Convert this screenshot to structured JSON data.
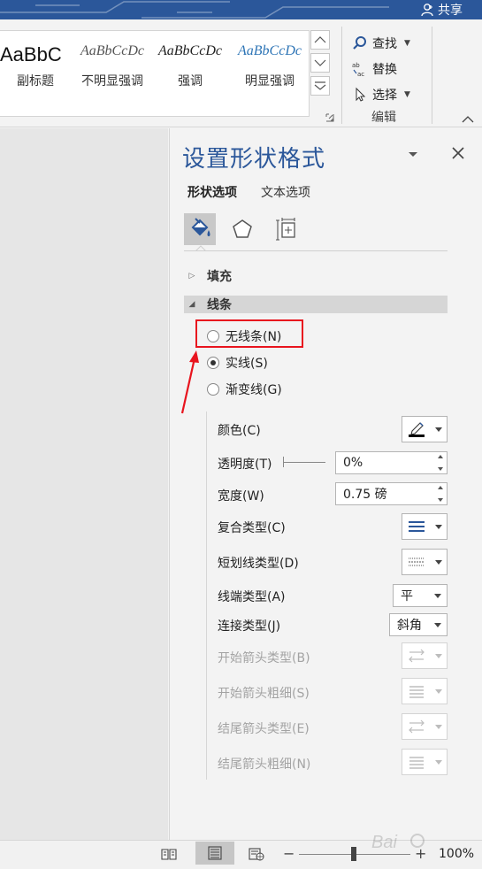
{
  "titlebar": {
    "share_label": "共享",
    "accent": "#2b579a"
  },
  "ribbon": {
    "styles": [
      {
        "sample": "AaBbC",
        "name": "副标题"
      },
      {
        "sample": "AaBbCcDc",
        "name": "不明显强调"
      },
      {
        "sample": "AaBbCcDc",
        "name": "强调"
      },
      {
        "sample": "AaBbCcDc",
        "name": "明显强调"
      }
    ],
    "edit_group": {
      "find": "查找",
      "replace": "替换",
      "select": "选择",
      "label": "编辑"
    }
  },
  "pane": {
    "title": "设置形状格式",
    "tabs": [
      "形状选项",
      "文本选项"
    ],
    "sections": {
      "fill": "填充",
      "line": "线条"
    },
    "line_options": [
      {
        "label": "无线条(N)",
        "checked": false,
        "highlighted": true
      },
      {
        "label": "实线(S)",
        "checked": true
      },
      {
        "label": "渐变线(G)",
        "checked": false
      }
    ],
    "properties": {
      "color": "颜色(C)",
      "transparency": "透明度(T)",
      "transparency_value": "0%",
      "width": "宽度(W)",
      "width_value": "0.75 磅",
      "compound_type": "复合类型(C)",
      "dash_type": "短划线类型(D)",
      "cap_type": "线端类型(A)",
      "cap_value": "平",
      "join_type": "连接类型(J)",
      "join_value": "斜角",
      "begin_arrow_type": "开始箭头类型(B)",
      "begin_arrow_size": "开始箭头粗细(S)",
      "end_arrow_type": "结尾箭头类型(E)",
      "end_arrow_size": "结尾箭头粗细(N)"
    },
    "annotation_color": "#e8141e"
  },
  "statusbar": {
    "zoom": "100%"
  }
}
